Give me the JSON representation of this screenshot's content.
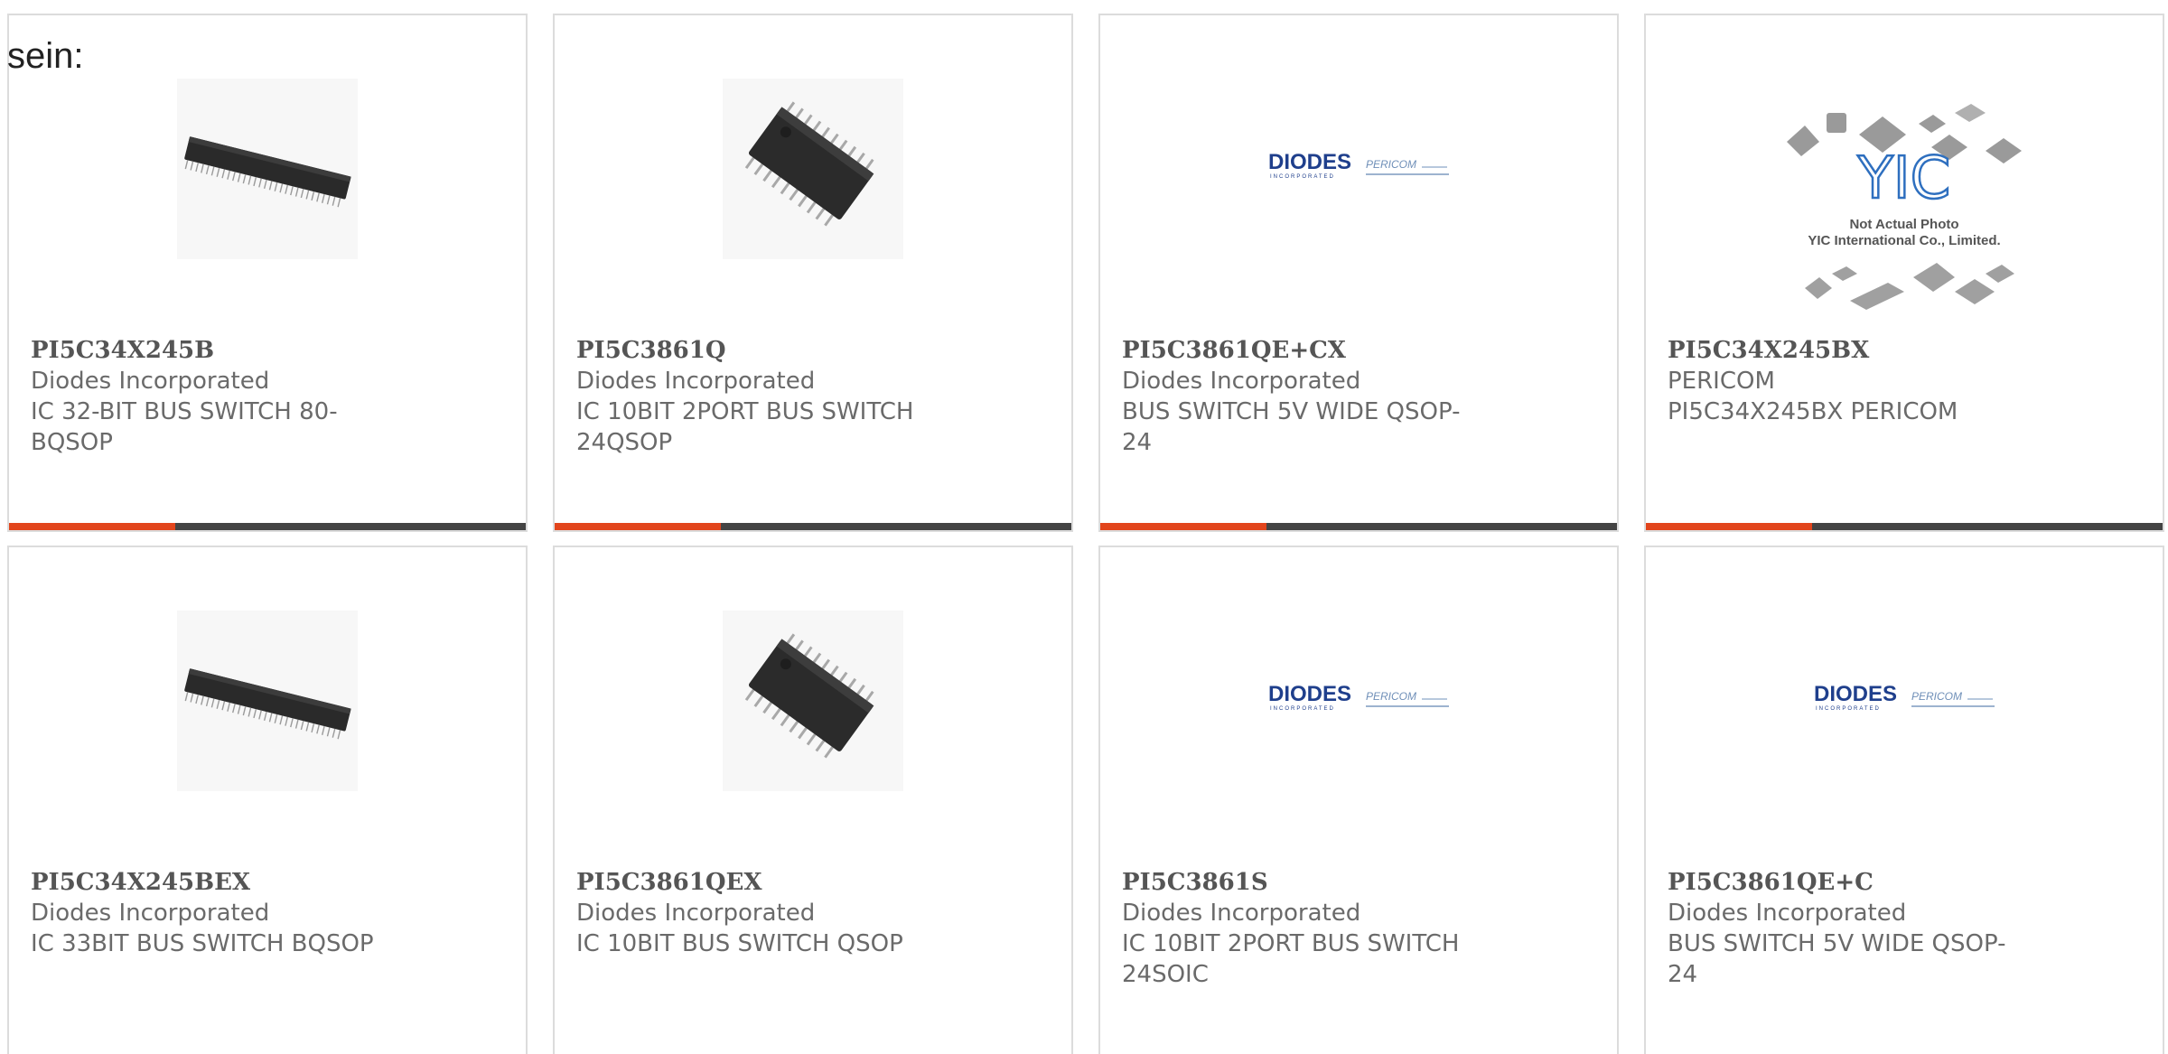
{
  "intro_text": "sein:",
  "accent_color": "#e2451c",
  "bar_color": "#444444",
  "cards": [
    {
      "part": "PI5C34X245B",
      "manufacturer": "Diodes Incorporated",
      "description": "IC 32-BIT BUS SWITCH 80-BQSOP",
      "image": "bqsop-chip-photo"
    },
    {
      "part": "PI5C3861Q",
      "manufacturer": "Diodes Incorporated",
      "description": "IC 10BIT 2PORT BUS SWITCH 24QSOP",
      "image": "qsop-chip-photo"
    },
    {
      "part": "PI5C3861QE+CX",
      "manufacturer": "Diodes Incorporated",
      "description": "BUS SWITCH 5V WIDE QSOP-24",
      "image": "diodes-pericom-logo"
    },
    {
      "part": "PI5C34X245BX",
      "manufacturer": "PERICOM",
      "description": "PI5C34X245BX PERICOM",
      "image": "yic-placeholder",
      "placeholder_caption_1": "Not Actual Photo",
      "placeholder_caption_2": "YIC International Co., Limited.",
      "placeholder_logo": "YIC"
    },
    {
      "part": "PI5C34X245BEX",
      "manufacturer": "Diodes Incorporated",
      "description": "IC 33BIT BUS SWITCH BQSOP",
      "image": "bqsop-chip-photo"
    },
    {
      "part": "PI5C3861QEX",
      "manufacturer": "Diodes Incorporated",
      "description": "IC 10BIT BUS SWITCH QSOP",
      "image": "qsop-chip-photo"
    },
    {
      "part": "PI5C3861S",
      "manufacturer": "Diodes Incorporated",
      "description": "IC 10BIT 2PORT BUS SWITCH 24SOIC",
      "image": "diodes-pericom-logo"
    },
    {
      "part": "PI5C3861QE+C",
      "manufacturer": "Diodes Incorporated",
      "description": "BUS SWITCH 5V WIDE QSOP-24",
      "image": "diodes-pericom-logo"
    }
  ],
  "logo_text": {
    "diodes": "DIODES",
    "diodes_sub": "INCORPORATED",
    "pericom": "PERICOM"
  }
}
